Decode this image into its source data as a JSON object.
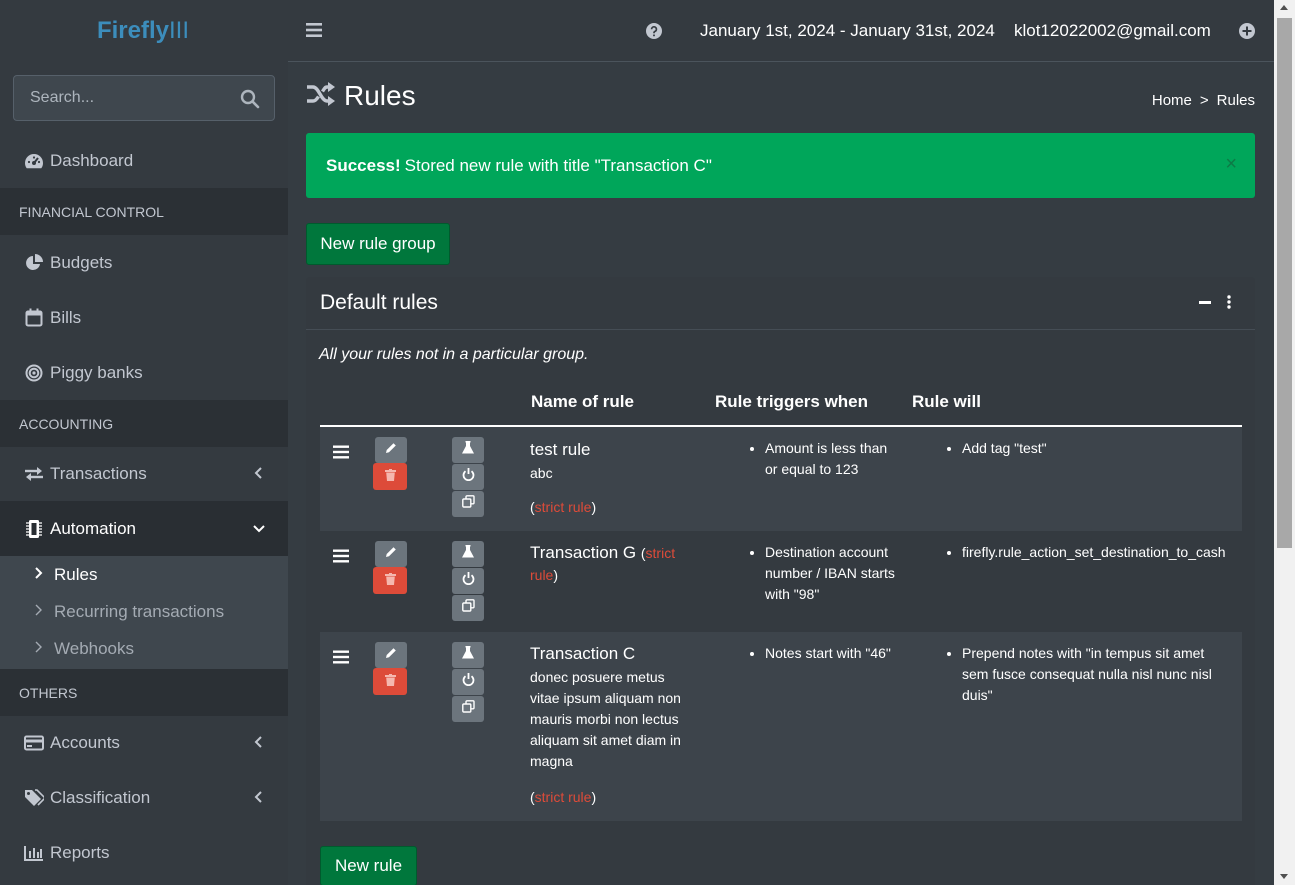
{
  "app": {
    "logo_bold": "Firefly",
    "logo_light": "III",
    "search_placeholder": "Search..."
  },
  "sidebar": {
    "dashboard": "Dashboard",
    "header_financial": "FINANCIAL CONTROL",
    "budgets": "Budgets",
    "bills": "Bills",
    "piggy_banks": "Piggy banks",
    "header_accounting": "ACCOUNTING",
    "transactions": "Transactions",
    "automation": "Automation",
    "sub_rules": "Rules",
    "sub_recurring": "Recurring transactions",
    "sub_webhooks": "Webhooks",
    "header_others": "OTHERS",
    "accounts": "Accounts",
    "classification": "Classification",
    "reports": "Reports"
  },
  "topbar": {
    "date_range": "January 1st, 2024 - January 31st, 2024",
    "user_email": "klot12022002@gmail.com"
  },
  "page": {
    "title": "Rules",
    "breadcrumb_home": "Home",
    "breadcrumb_sep": ">",
    "breadcrumb_current": "Rules"
  },
  "alert": {
    "strong": "Success!",
    "message": "Stored new rule with title \"Transaction C\"",
    "close": "×"
  },
  "buttons": {
    "new_rule_group": "New rule group",
    "new_rule": "New rule"
  },
  "card": {
    "title": "Default rules",
    "description": "All your rules not in a particular group."
  },
  "table": {
    "headers": [
      "Name of rule",
      "Rule triggers when",
      "Rule will"
    ],
    "rows": [
      {
        "name": "test rule",
        "description": "abc",
        "strict_open": "(",
        "strict_label": "strict rule",
        "strict_close": ")",
        "triggers": [
          "Amount is less than or equal to 123"
        ],
        "actions": [
          "Add tag \"test\""
        ]
      },
      {
        "name": "Transaction G",
        "description": "",
        "strict_open": "(",
        "strict_label": "strict rule",
        "strict_close": ")",
        "triggers": [
          "Destination account number / IBAN starts with \"98\""
        ],
        "actions": [
          "firefly.rule_action_set_destination_to_cash"
        ]
      },
      {
        "name": "Transaction C",
        "description": "donec posuere metus vitae ipsum aliquam non mauris morbi non lectus aliquam sit amet diam in magna",
        "strict_open": "(",
        "strict_label": "strict rule",
        "strict_close": ")",
        "triggers": [
          "Notes start with \"46\""
        ],
        "actions": [
          "Prepend notes with \"in tempus sit amet sem fusce consequat nulla nisl nunc nisl duis\""
        ]
      }
    ]
  },
  "colors": {
    "success": "#00a65a",
    "danger": "#dd4b39",
    "brand": "#3c8dbc",
    "button_green": "#00773c"
  }
}
